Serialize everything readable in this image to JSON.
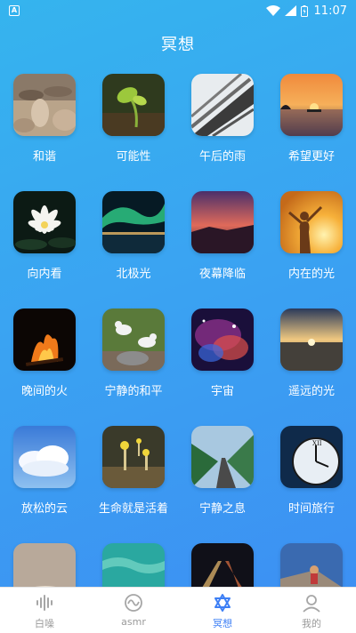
{
  "status": {
    "time": "11:07"
  },
  "page": {
    "title": "冥想"
  },
  "items": [
    {
      "label": "和谐",
      "image": "stones"
    },
    {
      "label": "可能性",
      "image": "sprout"
    },
    {
      "label": "午后的雨",
      "image": "roof-rain"
    },
    {
      "label": "希望更好",
      "image": "sunset-sea"
    },
    {
      "label": "向内看",
      "image": "lotus"
    },
    {
      "label": "北极光",
      "image": "aurora"
    },
    {
      "label": "夜幕降临",
      "image": "dusk"
    },
    {
      "label": "内在的光",
      "image": "sun-person"
    },
    {
      "label": "晚间的火",
      "image": "campfire"
    },
    {
      "label": "宁静的和平",
      "image": "doves"
    },
    {
      "label": "宇宙",
      "image": "nebula"
    },
    {
      "label": "遥远的光",
      "image": "horizon"
    },
    {
      "label": "放松的云",
      "image": "clouds"
    },
    {
      "label": "生命就是活着",
      "image": "mushrooms"
    },
    {
      "label": "宁静之息",
      "image": "road-trees"
    },
    {
      "label": "时间旅行",
      "image": "clock"
    },
    {
      "label": "",
      "image": "cat"
    },
    {
      "label": "",
      "image": "water"
    },
    {
      "label": "",
      "image": "night-road"
    },
    {
      "label": "",
      "image": "climber"
    }
  ],
  "nav": [
    {
      "label": "白噪",
      "icon": "waveform-icon",
      "active": false
    },
    {
      "label": "asmr",
      "icon": "asmr-wave-icon",
      "active": false
    },
    {
      "label": "冥想",
      "icon": "star-of-david-icon",
      "active": true
    },
    {
      "label": "我的",
      "icon": "profile-icon",
      "active": false
    }
  ]
}
